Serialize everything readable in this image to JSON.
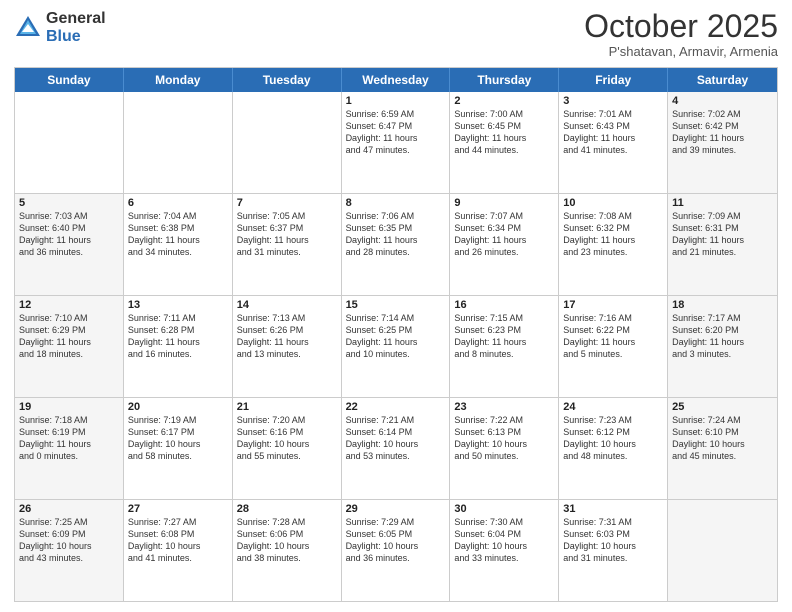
{
  "logo": {
    "general": "General",
    "blue": "Blue"
  },
  "title": "October 2025",
  "subtitle": "P'shatavan, Armavir, Armenia",
  "days_of_week": [
    "Sunday",
    "Monday",
    "Tuesday",
    "Wednesday",
    "Thursday",
    "Friday",
    "Saturday"
  ],
  "weeks": [
    [
      {
        "day": "",
        "text": "",
        "shaded": false
      },
      {
        "day": "",
        "text": "",
        "shaded": false
      },
      {
        "day": "",
        "text": "",
        "shaded": false
      },
      {
        "day": "1",
        "text": "Sunrise: 6:59 AM\nSunset: 6:47 PM\nDaylight: 11 hours\nand 47 minutes.",
        "shaded": false
      },
      {
        "day": "2",
        "text": "Sunrise: 7:00 AM\nSunset: 6:45 PM\nDaylight: 11 hours\nand 44 minutes.",
        "shaded": false
      },
      {
        "day": "3",
        "text": "Sunrise: 7:01 AM\nSunset: 6:43 PM\nDaylight: 11 hours\nand 41 minutes.",
        "shaded": false
      },
      {
        "day": "4",
        "text": "Sunrise: 7:02 AM\nSunset: 6:42 PM\nDaylight: 11 hours\nand 39 minutes.",
        "shaded": true
      }
    ],
    [
      {
        "day": "5",
        "text": "Sunrise: 7:03 AM\nSunset: 6:40 PM\nDaylight: 11 hours\nand 36 minutes.",
        "shaded": true
      },
      {
        "day": "6",
        "text": "Sunrise: 7:04 AM\nSunset: 6:38 PM\nDaylight: 11 hours\nand 34 minutes.",
        "shaded": false
      },
      {
        "day": "7",
        "text": "Sunrise: 7:05 AM\nSunset: 6:37 PM\nDaylight: 11 hours\nand 31 minutes.",
        "shaded": false
      },
      {
        "day": "8",
        "text": "Sunrise: 7:06 AM\nSunset: 6:35 PM\nDaylight: 11 hours\nand 28 minutes.",
        "shaded": false
      },
      {
        "day": "9",
        "text": "Sunrise: 7:07 AM\nSunset: 6:34 PM\nDaylight: 11 hours\nand 26 minutes.",
        "shaded": false
      },
      {
        "day": "10",
        "text": "Sunrise: 7:08 AM\nSunset: 6:32 PM\nDaylight: 11 hours\nand 23 minutes.",
        "shaded": false
      },
      {
        "day": "11",
        "text": "Sunrise: 7:09 AM\nSunset: 6:31 PM\nDaylight: 11 hours\nand 21 minutes.",
        "shaded": true
      }
    ],
    [
      {
        "day": "12",
        "text": "Sunrise: 7:10 AM\nSunset: 6:29 PM\nDaylight: 11 hours\nand 18 minutes.",
        "shaded": true
      },
      {
        "day": "13",
        "text": "Sunrise: 7:11 AM\nSunset: 6:28 PM\nDaylight: 11 hours\nand 16 minutes.",
        "shaded": false
      },
      {
        "day": "14",
        "text": "Sunrise: 7:13 AM\nSunset: 6:26 PM\nDaylight: 11 hours\nand 13 minutes.",
        "shaded": false
      },
      {
        "day": "15",
        "text": "Sunrise: 7:14 AM\nSunset: 6:25 PM\nDaylight: 11 hours\nand 10 minutes.",
        "shaded": false
      },
      {
        "day": "16",
        "text": "Sunrise: 7:15 AM\nSunset: 6:23 PM\nDaylight: 11 hours\nand 8 minutes.",
        "shaded": false
      },
      {
        "day": "17",
        "text": "Sunrise: 7:16 AM\nSunset: 6:22 PM\nDaylight: 11 hours\nand 5 minutes.",
        "shaded": false
      },
      {
        "day": "18",
        "text": "Sunrise: 7:17 AM\nSunset: 6:20 PM\nDaylight: 11 hours\nand 3 minutes.",
        "shaded": true
      }
    ],
    [
      {
        "day": "19",
        "text": "Sunrise: 7:18 AM\nSunset: 6:19 PM\nDaylight: 11 hours\nand 0 minutes.",
        "shaded": true
      },
      {
        "day": "20",
        "text": "Sunrise: 7:19 AM\nSunset: 6:17 PM\nDaylight: 10 hours\nand 58 minutes.",
        "shaded": false
      },
      {
        "day": "21",
        "text": "Sunrise: 7:20 AM\nSunset: 6:16 PM\nDaylight: 10 hours\nand 55 minutes.",
        "shaded": false
      },
      {
        "day": "22",
        "text": "Sunrise: 7:21 AM\nSunset: 6:14 PM\nDaylight: 10 hours\nand 53 minutes.",
        "shaded": false
      },
      {
        "day": "23",
        "text": "Sunrise: 7:22 AM\nSunset: 6:13 PM\nDaylight: 10 hours\nand 50 minutes.",
        "shaded": false
      },
      {
        "day": "24",
        "text": "Sunrise: 7:23 AM\nSunset: 6:12 PM\nDaylight: 10 hours\nand 48 minutes.",
        "shaded": false
      },
      {
        "day": "25",
        "text": "Sunrise: 7:24 AM\nSunset: 6:10 PM\nDaylight: 10 hours\nand 45 minutes.",
        "shaded": true
      }
    ],
    [
      {
        "day": "26",
        "text": "Sunrise: 7:25 AM\nSunset: 6:09 PM\nDaylight: 10 hours\nand 43 minutes.",
        "shaded": true
      },
      {
        "day": "27",
        "text": "Sunrise: 7:27 AM\nSunset: 6:08 PM\nDaylight: 10 hours\nand 41 minutes.",
        "shaded": false
      },
      {
        "day": "28",
        "text": "Sunrise: 7:28 AM\nSunset: 6:06 PM\nDaylight: 10 hours\nand 38 minutes.",
        "shaded": false
      },
      {
        "day": "29",
        "text": "Sunrise: 7:29 AM\nSunset: 6:05 PM\nDaylight: 10 hours\nand 36 minutes.",
        "shaded": false
      },
      {
        "day": "30",
        "text": "Sunrise: 7:30 AM\nSunset: 6:04 PM\nDaylight: 10 hours\nand 33 minutes.",
        "shaded": false
      },
      {
        "day": "31",
        "text": "Sunrise: 7:31 AM\nSunset: 6:03 PM\nDaylight: 10 hours\nand 31 minutes.",
        "shaded": false
      },
      {
        "day": "",
        "text": "",
        "shaded": true
      }
    ]
  ]
}
